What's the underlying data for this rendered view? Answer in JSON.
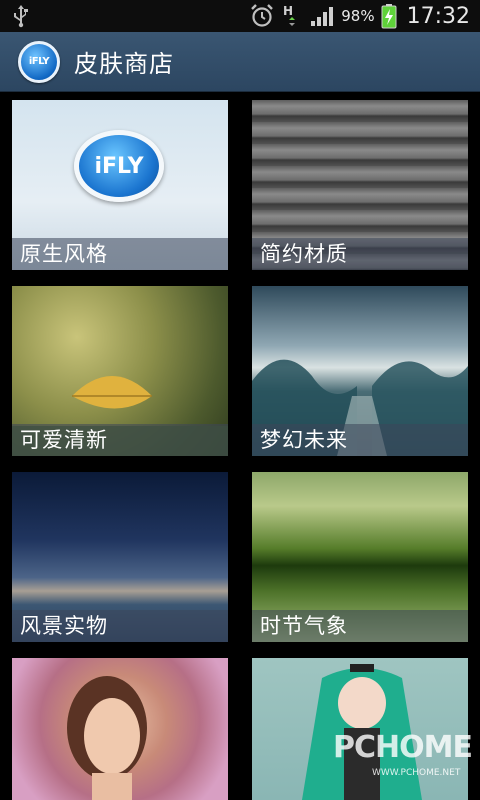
{
  "status_bar": {
    "battery_percent": "98%",
    "time": "17:32",
    "icons": [
      "usb-icon",
      "alarm-icon",
      "data-h-icon",
      "signal-icon",
      "battery-charging-icon"
    ]
  },
  "header": {
    "logo_text": "iFLY",
    "title": "皮肤商店"
  },
  "categories": [
    {
      "label": "原生风格",
      "art": "ifly",
      "badge_text": "iFLY"
    },
    {
      "label": "简约材质",
      "art": "wood"
    },
    {
      "label": "可爱清新",
      "art": "leaf"
    },
    {
      "label": "梦幻未来",
      "art": "storm"
    },
    {
      "label": "风景实物",
      "art": "sea"
    },
    {
      "label": "时节气象",
      "art": "rain"
    },
    {
      "label": "",
      "art": "portrait"
    },
    {
      "label": "",
      "art": "anime"
    }
  ],
  "watermark": {
    "main": "PCHOME",
    "sub": "WWW.PCHOME.NET"
  }
}
